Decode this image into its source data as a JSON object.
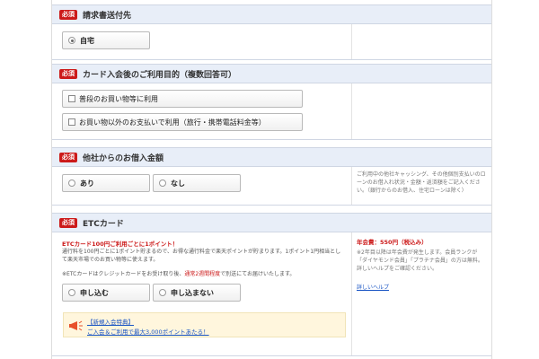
{
  "required_badge": "必須",
  "billing": {
    "title": "請求書送付先",
    "option": "自宅"
  },
  "purpose": {
    "title": "カード入会後のご利用目的（複数回答可）",
    "options": [
      "普段のお買い物等に利用",
      "お買い物以外のお支払いで利用（旅行・携帯電話料金等）"
    ]
  },
  "borrowing": {
    "title": "他社からのお借入金額",
    "options": [
      "あり",
      "なし"
    ],
    "note": "ご利用中の他社キャッシング、その他個別支払いのローンのお借入れ状況・金額・返済額をご記入ください。（銀行からのお借入、住宅ローンは除く）"
  },
  "etc": {
    "title": "ETCカード",
    "promo": "ETCカード100円ご利用ごとに1ポイント！",
    "desc": "通行料を100円ごとに1ポイント貯まるので、お得な通行料金で楽天ポイントが貯まります。1ポイント1円相当として楽天市場でのお買い物等に使えます。",
    "note_prefix": "※ETCカードはクレジットカードをお受け取り後、",
    "note_red": "通常2週間程度",
    "note_suffix": "で別送にてお届けいたします。",
    "options": [
      "申し込む",
      "申し込まない"
    ],
    "banner_line1": "【新規入会特典】",
    "banner_line2": "ご入会＆ご利用で最大3,000ポイントあたる！",
    "fee": "年会費：550円（税込み）",
    "fee_note": "※2年目以降は年会費が発生します。会員ランクが「ダイヤモンド会員」「プラチナ会員」の方は無料。詳しいヘルプをご確認ください。",
    "help_link": "詳しいヘルプ"
  },
  "colors": {
    "required": "#cc1a1a",
    "header_bg": "#e8eef8",
    "link": "#1a55c4"
  }
}
